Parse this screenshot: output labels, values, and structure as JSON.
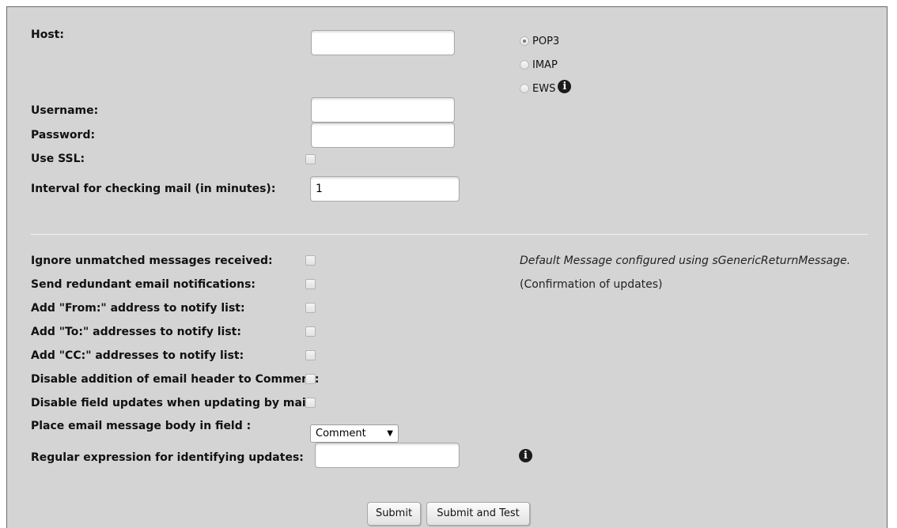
{
  "form": {
    "host_label": "Host:",
    "host_value": "",
    "protocols": [
      {
        "label": "POP3",
        "selected": true
      },
      {
        "label": "IMAP",
        "selected": false
      },
      {
        "label": "EWS",
        "selected": false
      }
    ],
    "info_glyph": "i",
    "username_label": "Username:",
    "username_value": "",
    "password_label": "Password:",
    "password_value": "",
    "use_ssl_label": "Use SSL:",
    "interval_label": "Interval for checking mail (in minutes):",
    "interval_value": "1",
    "options": [
      {
        "label": "Ignore unmatched messages received:",
        "checked": false
      },
      {
        "label": "Send redundant email notifications:",
        "checked": false
      },
      {
        "label": "Add \"From:\" address to notify list:",
        "checked": false
      },
      {
        "label": "Add \"To:\" addresses to notify list:",
        "checked": false
      },
      {
        "label": "Add \"CC:\" addresses to notify list:",
        "checked": false
      },
      {
        "label": "Disable addition of email header to Comment:",
        "checked": false
      },
      {
        "label": "Disable field updates when updating by mail:",
        "checked": false
      }
    ],
    "ignore_note": "Default Message configured using sGenericReturnMessage.",
    "redundant_note": "(Confirmation of updates)",
    "body_field_label": "Place email message body in field :",
    "body_field_value": "Comment",
    "regex_label": "Regular expression for identifying updates:",
    "regex_value": "",
    "submit_label": "Submit",
    "submit_test_label": "Submit and Test"
  },
  "icons": [
    "info-icon",
    "dropdown-arrow-icon"
  ],
  "colors": {
    "panel_bg": "#d4d4d4",
    "border": "#6b6b6b"
  }
}
